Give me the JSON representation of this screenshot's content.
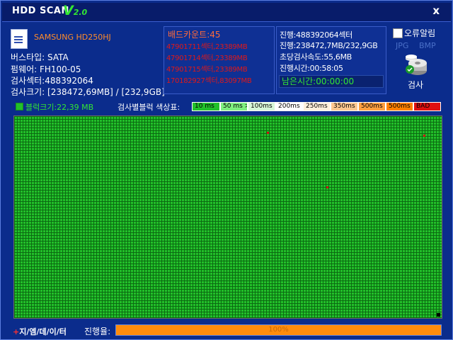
{
  "window": {
    "title": "HDD SCAN",
    "version_prefix": "V",
    "version_num": "2.0",
    "close_label": "x"
  },
  "drive": {
    "model": "SAMSUNG HD250HJ",
    "bus": "버스타입: SATA",
    "firmware": "펌웨어: FH100-05",
    "sectors": "검사섹터:488392064",
    "size": "검사크기: [238472,69MB] / [232,9GB]"
  },
  "bad": {
    "title": "배드카운트:45",
    "items": [
      "47901711섹터,23389MB",
      "47901714섹터,23389MB",
      "47901715섹터,23389MB",
      "170182927섹터,83097MB"
    ]
  },
  "progress_info": {
    "sector": "진행:488392064섹터",
    "size": "진행:238472,7MB/232,9GB",
    "speed": "초당검사속도:55,6MB",
    "elapsed": "진행시간:00:58:05",
    "remaining": "남은시간:00:00:00"
  },
  "options": {
    "error_alarm": "오류알림",
    "jpg": "JPG",
    "bmp": "BMP",
    "scan": "검사"
  },
  "block": {
    "size": "블럭크기:22,39 MB",
    "legend_label": "검사별블럭 색상표:"
  },
  "legend": [
    {
      "label": "10 ms",
      "color": "#22c02a"
    },
    {
      "label": "50 ms >",
      "color": "#7ff07f"
    },
    {
      "label": "100ms >",
      "color": "#d8f8d8"
    },
    {
      "label": "200ms >",
      "color": "#ffffff"
    },
    {
      "label": "250ms >",
      "color": "#fff0dc"
    },
    {
      "label": "350ms >",
      "color": "#ffc890"
    },
    {
      "label": "500ms >",
      "color": "#ffa040"
    },
    {
      "label": "500ms <",
      "color": "#ff8000"
    },
    {
      "label": "BAD",
      "color": "#e01010"
    }
  ],
  "footer": {
    "brand_plus": "+",
    "brand": "지/엠/데/이/터",
    "progress_label": "진행율:",
    "progress_text": "100%",
    "progress_value": 1.0
  }
}
